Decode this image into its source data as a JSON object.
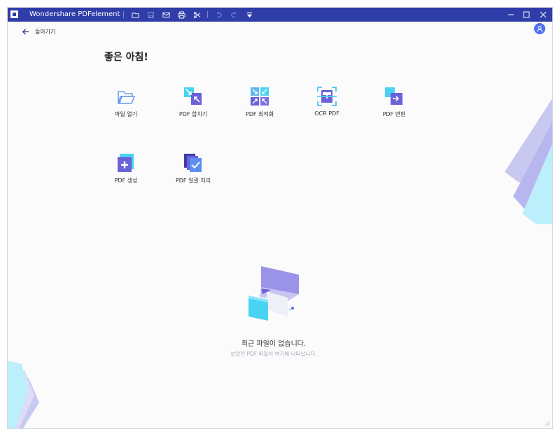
{
  "window": {
    "title": "Wondershare PDFelement"
  },
  "toolbar": {
    "icons": [
      "folder-icon",
      "save-icon",
      "mail-icon",
      "print-icon",
      "scissors-icon",
      "undo-icon",
      "redo-icon",
      "dropdown-icon"
    ]
  },
  "nav": {
    "back_label": "돌아가기"
  },
  "greeting": "좋은 아침!",
  "tools": [
    {
      "label": "파일 열기",
      "icon": "folder-open-icon"
    },
    {
      "label": "PDF 합치기",
      "icon": "combine-icon"
    },
    {
      "label": "PDF 최적화",
      "icon": "optimize-icon"
    },
    {
      "label": "OCR PDF",
      "icon": "ocr-icon"
    },
    {
      "label": "PDF 변환",
      "icon": "convert-icon"
    },
    {
      "label": "PDF 생성",
      "icon": "create-icon"
    },
    {
      "label": "PDF 일괄 처리",
      "icon": "batch-icon"
    }
  ],
  "recent": {
    "empty_title": "최근 파일이 없습니다.",
    "empty_subtitle": "보았던 PDF 파일이 여기에 나타납니다."
  },
  "colors": {
    "titlebar": "#2f3da8",
    "accent": "#4f6ff0",
    "cyan": "#49d3f2",
    "purple": "#6a62d8"
  }
}
